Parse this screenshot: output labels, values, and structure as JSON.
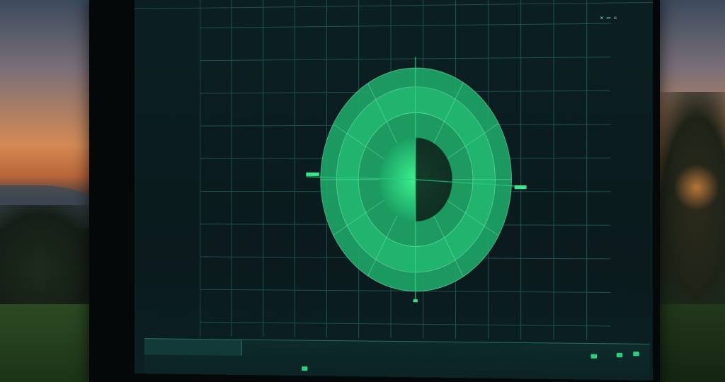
{
  "top_bar": {
    "title": "",
    "mid_label": "",
    "status": "",
    "right_label": "",
    "icons": [
      "close-icon",
      "window-icon",
      "minimize-icon"
    ]
  },
  "left_panel": {
    "items": [
      "",
      "",
      "",
      "",
      "",
      "",
      "",
      "",
      "",
      "",
      "",
      "",
      "",
      "",
      "",
      "",
      "",
      "",
      "",
      "",
      "",
      "",
      "",
      "",
      "",
      "",
      "",
      "",
      "",
      ""
    ]
  },
  "right_panel": {
    "items": [
      "",
      "",
      "",
      "",
      "",
      "",
      "",
      "",
      "",
      "",
      "",
      "",
      "",
      "",
      "",
      "",
      "",
      "",
      "",
      "",
      "",
      "",
      "",
      "",
      "",
      "",
      "",
      "",
      "",
      "",
      ""
    ]
  },
  "bottom_bar": {
    "tab_label": "",
    "line1": "",
    "line2": "",
    "mid": "",
    "right": ""
  },
  "colors": {
    "accent": "#27d17e",
    "accent_dark": "#1a8f5c",
    "grid": "#1f5a55",
    "text": "#7cc8b3",
    "screen_bg": "#0a1a1d"
  },
  "radar": {
    "rings": 4,
    "sectors": 12,
    "axis_markers": [
      "north-marker",
      "south-marker",
      "east-marker",
      "west-marker"
    ]
  }
}
